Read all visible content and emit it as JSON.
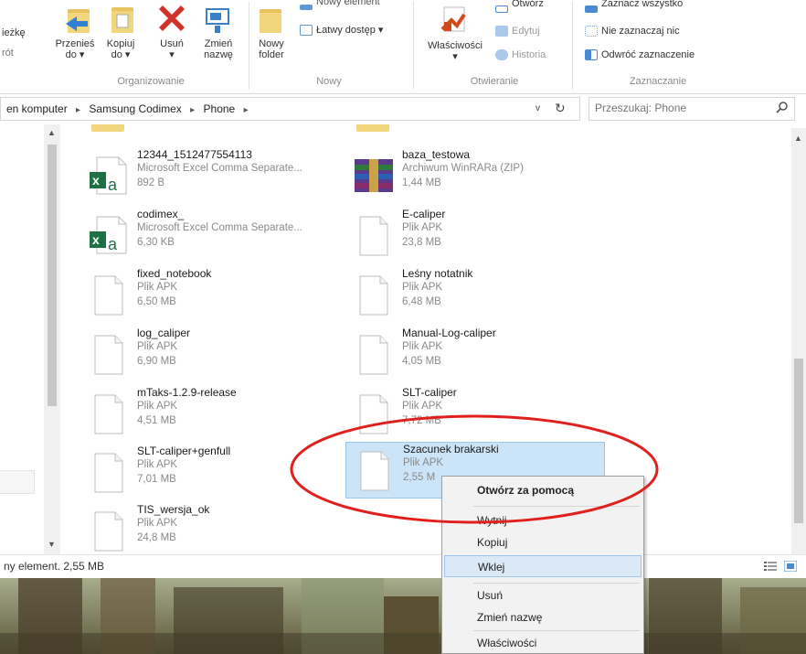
{
  "ribbon": {
    "partial_left_1": "ieżkę",
    "partial_left_2": "rót",
    "move_to": "Przenieś do ▾",
    "move_to_l1": "Przenieś",
    "move_to_l2": "do ▾",
    "copy_to_l1": "Kopiuj",
    "copy_to_l2": "do ▾",
    "delete_l1": "Usuń",
    "delete_l2": "▾",
    "rename_l1": "Zmień",
    "rename_l2": "nazwę",
    "new_folder_l1": "Nowy",
    "new_folder_l2": "folder",
    "new_item": "Nowy element",
    "easy_access": "Łatwy dostęp ▾",
    "properties_l1": "Właściwości",
    "properties_l2": "▾",
    "open": "Otwórz",
    "edit": "Edytuj",
    "history": "Historia",
    "select_all": "Zaznacz wszystko",
    "select_none": "Nie zaznaczaj nic",
    "invert_selection": "Odwróć zaznaczenie",
    "groups": {
      "organize": "Organizowanie",
      "new": "Nowy",
      "open": "Otwieranie",
      "select": "Zaznaczanie"
    }
  },
  "address": {
    "crumb_0": "en komputer",
    "crumb_1": "Samsung Codimex",
    "crumb_2": "Phone",
    "sep": "▸",
    "dropdown": "v",
    "refresh": "↻"
  },
  "search": {
    "placeholder": "Przeszukaj: Phone"
  },
  "files": [
    {
      "name": "12344_1512477554113",
      "type": "Microsoft Excel Comma Separate...",
      "size": "892 B",
      "icon": "excel-csv-icon"
    },
    {
      "name": "baza_testowa",
      "type": "Archiwum WinRARa (ZIP)",
      "size": "1,44 MB",
      "icon": "winrar-archive-icon"
    },
    {
      "name": "codimex_",
      "type": "Microsoft Excel Comma Separate...",
      "size": "6,30 KB",
      "icon": "excel-csv-icon"
    },
    {
      "name": "E-caliper",
      "type": "Plik APK",
      "size": "23,8 MB",
      "icon": "file-icon"
    },
    {
      "name": "fixed_notebook",
      "type": "Plik APK",
      "size": "6,50 MB",
      "icon": "file-icon"
    },
    {
      "name": "Leśny notatnik",
      "type": "Plik APK",
      "size": "6,48 MB",
      "icon": "file-icon"
    },
    {
      "name": "log_caliper",
      "type": "Plik APK",
      "size": "6,90 MB",
      "icon": "file-icon"
    },
    {
      "name": "Manual-Log-caliper",
      "type": "Plik APK",
      "size": "4,05 MB",
      "icon": "file-icon"
    },
    {
      "name": "mTaks-1.2.9-release",
      "type": "Plik APK",
      "size": "4,51 MB",
      "icon": "file-icon"
    },
    {
      "name": "SLT-caliper",
      "type": "Plik APK",
      "size": "7,72 MB",
      "icon": "file-icon"
    },
    {
      "name": "SLT-caliper+genfull",
      "type": "Plik APK",
      "size": "7,01 MB",
      "icon": "file-icon"
    },
    {
      "name": "Szacunek brakarski",
      "type": "Plik APK",
      "size": "2,55 M",
      "icon": "file-icon",
      "selected": true
    },
    {
      "name": "TIS_wersja_ok",
      "type": "Plik APK",
      "size": "24,8 MB",
      "icon": "file-icon"
    }
  ],
  "status": {
    "text": "ny element. 2,55 MB"
  },
  "context_menu": {
    "items": [
      {
        "label": "Otwórz za pomocą",
        "bold": true
      },
      {
        "label": "Wytnij"
      },
      {
        "label": "Kopiuj"
      },
      {
        "label": "Wklej",
        "highlighted": true
      },
      {
        "label": "Usuń"
      },
      {
        "label": "Zmień nazwę"
      },
      {
        "label": "Właściwości"
      }
    ]
  },
  "colors": {
    "selection_bg": "#cce4f7",
    "selection_border": "#99c9ef",
    "annotation_red": "#e0201c",
    "excel_green": "#1e7145",
    "menu_highlight": "#dbe9f7"
  }
}
